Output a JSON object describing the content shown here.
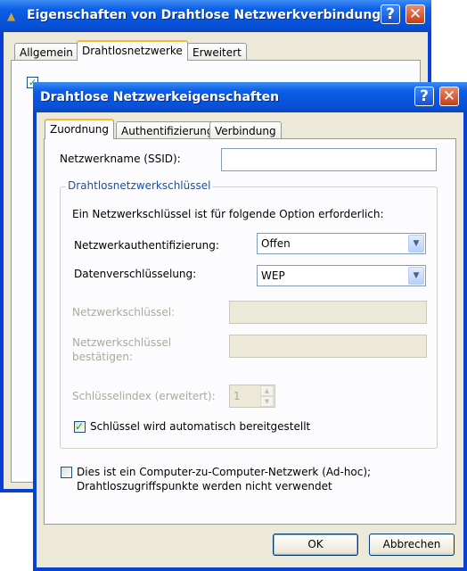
{
  "back_window": {
    "title": "Eigenschaften von Drahtlose Netzwerkverbindung",
    "help_glyph": "?",
    "close_glyph": "✕",
    "tabs": [
      {
        "label": "Allgemein",
        "active": false
      },
      {
        "label": "Drahtlosnetzwerke",
        "active": true
      },
      {
        "label": "Erweitert",
        "active": false
      }
    ]
  },
  "dialog": {
    "title": "Drahtlose Netzwerkeigenschaften",
    "help_glyph": "?",
    "close_glyph": "✕",
    "tabs": [
      {
        "label": "Zuordnung",
        "active": true
      },
      {
        "label": "Authentifizierung",
        "active": false
      },
      {
        "label": "Verbindung",
        "active": false
      }
    ],
    "ssid": {
      "label": "Netzwerkname (SSID):",
      "value": ""
    },
    "key_group": {
      "title": "Drahtlosnetzwerkschlüssel",
      "intro": "Ein Netzwerkschlüssel ist für folgende Option erforderlich:",
      "auth": {
        "label": "Netzwerkauthentifizierung:",
        "value": "Offen"
      },
      "encryption": {
        "label": "Datenverschlüsselung:",
        "value": "WEP"
      },
      "network_key": {
        "label": "Netzwerkschlüssel:",
        "value": "",
        "enabled": false
      },
      "confirm_key": {
        "label_line1": "Netzwerkschlüssel",
        "label_line2": "bestätigen:",
        "value": "",
        "enabled": false
      },
      "key_index": {
        "label": "Schlüsselindex (erweitert):",
        "value": "1",
        "enabled": false
      },
      "auto_key": {
        "label": "Schlüssel wird automatisch bereitgestellt",
        "checked": true
      }
    },
    "adhoc": {
      "label_line1": "Dies ist ein Computer-zu-Computer-Netzwerk (Ad-hoc);",
      "label_line2": "Drahtloszugriffspunkte werden nicht verwendet",
      "checked": false
    },
    "buttons": {
      "ok": "OK",
      "cancel": "Abbrechen"
    }
  },
  "colors": {
    "titlebar": "#0a5ce5",
    "face": "#ece9d8",
    "tab_highlight": "#f8b838",
    "group_title": "#1c4fa6",
    "disabled_text": "#aca899",
    "check": "#21a121"
  }
}
